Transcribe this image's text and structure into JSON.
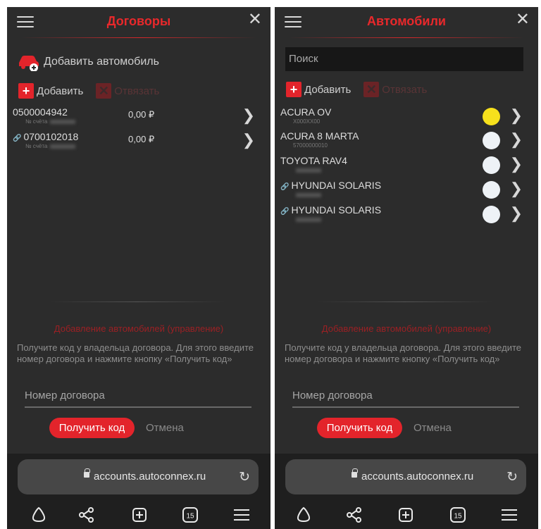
{
  "left": {
    "title": "Договоры",
    "add_car": "Добавить автомобиль",
    "add": "Добавить",
    "unlink": "Отвязать",
    "rows": [
      {
        "number": "0500004942",
        "sub": "№ счёта",
        "amount": "0,00 ₽"
      },
      {
        "number": "0700102018",
        "sub": "№ счёта",
        "amount": "0,00 ₽"
      }
    ]
  },
  "right": {
    "title": "Автомобили",
    "search_placeholder": "Поиск",
    "add": "Добавить",
    "unlink": "Отвязать",
    "cars": [
      {
        "name": "ACURA OV",
        "plate": "X000XX00",
        "status_color": "#f7e11c"
      },
      {
        "name": "ACURA 8 MARTA",
        "plate": "57000000010",
        "status_color": "#eef2f6"
      },
      {
        "name": "TOYOTA RAV4",
        "plate": "",
        "status_color": "#eef2f6"
      },
      {
        "name": "HYUNDAI SOLARIS",
        "plate": "",
        "status_color": "#eef2f6"
      },
      {
        "name": "HYUNDAI SOLARIS",
        "plate": "",
        "status_color": "#eef2f6"
      }
    ]
  },
  "common": {
    "section_title": "Добавление автомобилей (управление)",
    "section_text": "Получите код у владельца договора. Для этого введите номер договора и нажмите кнопку «Получить код»",
    "contract_placeholder": "Номер договора",
    "get_code": "Получить код",
    "cancel": "Отмена",
    "url": "accounts.autoconnex.ru",
    "tabs_count": "15"
  },
  "colors": {
    "accent": "#e3242b",
    "background": "#2c2c2c",
    "status_yellow": "#f7e11c"
  },
  "icons": [
    "menu-icon",
    "close-icon",
    "car-add-icon",
    "plus-icon",
    "unlink-icon",
    "link-icon",
    "chevron-right-icon",
    "lock-icon",
    "reload-icon",
    "home-icon",
    "share-icon",
    "new-tab-icon",
    "tabs-icon",
    "browser-menu-icon"
  ]
}
